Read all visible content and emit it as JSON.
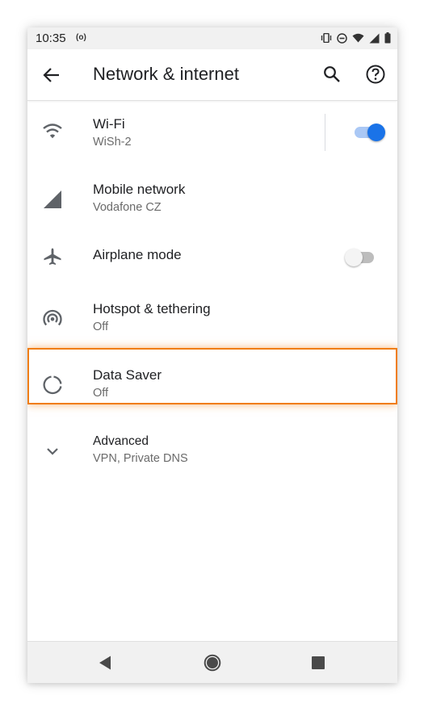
{
  "status_bar": {
    "time": "10:35",
    "radio_indicator": "(o)",
    "icons": [
      "vibrate-icon",
      "do-not-disturb-icon",
      "wifi-signal-icon",
      "cell-signal-icon",
      "battery-icon"
    ]
  },
  "app_bar": {
    "title": "Network & internet",
    "back_icon": "arrow-back-icon",
    "search_icon": "search-icon",
    "help_icon": "help-icon"
  },
  "settings": {
    "items": [
      {
        "title": "Wi-Fi",
        "subtitle": "WiSh-2",
        "icon": "wifi-icon",
        "toggle": "on"
      },
      {
        "title": "Mobile network",
        "subtitle": "Vodafone CZ",
        "icon": "cell-signal-icon"
      },
      {
        "title": "Airplane mode",
        "icon": "airplane-icon",
        "toggle": "off"
      },
      {
        "title": "Hotspot & tethering",
        "subtitle": "Off",
        "icon": "hotspot-icon"
      },
      {
        "title": "Data Saver",
        "subtitle": "Off",
        "icon": "data-saver-icon",
        "highlighted": true
      },
      {
        "title": "Advanced",
        "subtitle": "VPN, Private DNS",
        "icon": "chevron-down-icon"
      }
    ]
  },
  "nav_bar": {
    "icons": [
      "nav-back-icon",
      "nav-home-icon",
      "nav-recents-icon"
    ]
  },
  "colors": {
    "accent": "#1a73e8",
    "highlight": "#f07d12",
    "icon_gray": "#5f6368"
  }
}
